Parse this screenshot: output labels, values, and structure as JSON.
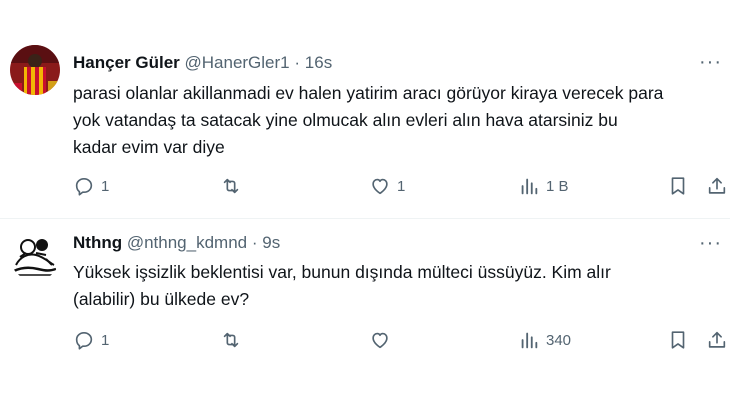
{
  "tweets": [
    {
      "author": {
        "name": "Hançer Güler",
        "handle": "@HanerGler1",
        "separator": "·",
        "time": "16s",
        "avatar_icon": "profile-photo-red-yellow"
      },
      "more_label": "···",
      "text_lines": [
        "parasi olanlar akillanmadi ev halen yatirim aracı görüyor kiraya verecek para",
        "yok vatandaş ta satacak yine olmucak alın evleri alın hava atarsiniz bu",
        "kadar evim var diye"
      ],
      "actions": {
        "replies": "1",
        "retweets": "",
        "likes": "1",
        "views": "1 B"
      }
    },
    {
      "author": {
        "name": "Nthng",
        "handle": "@nthng_kdmnd",
        "separator": "·",
        "time": "9s",
        "avatar_icon": "sketch-drawing-avatar"
      },
      "more_label": "···",
      "text_lines": [
        "Yüksek işsizlik beklentisi var, bunun dışında mülteci üssüyüz. Kim alır",
        "(alabilir) bu ülkede ev?"
      ],
      "actions": {
        "replies": "1",
        "retweets": "",
        "likes": "",
        "views": "340"
      }
    }
  ],
  "icons": {
    "reply": "reply-icon",
    "retweet": "retweet-icon",
    "like": "heart-icon",
    "views": "views-chart-icon",
    "bookmark": "bookmark-icon",
    "share": "share-icon"
  },
  "colors": {
    "text": "#0f1419",
    "secondary": "#536471",
    "divider": "#eff3f4"
  }
}
